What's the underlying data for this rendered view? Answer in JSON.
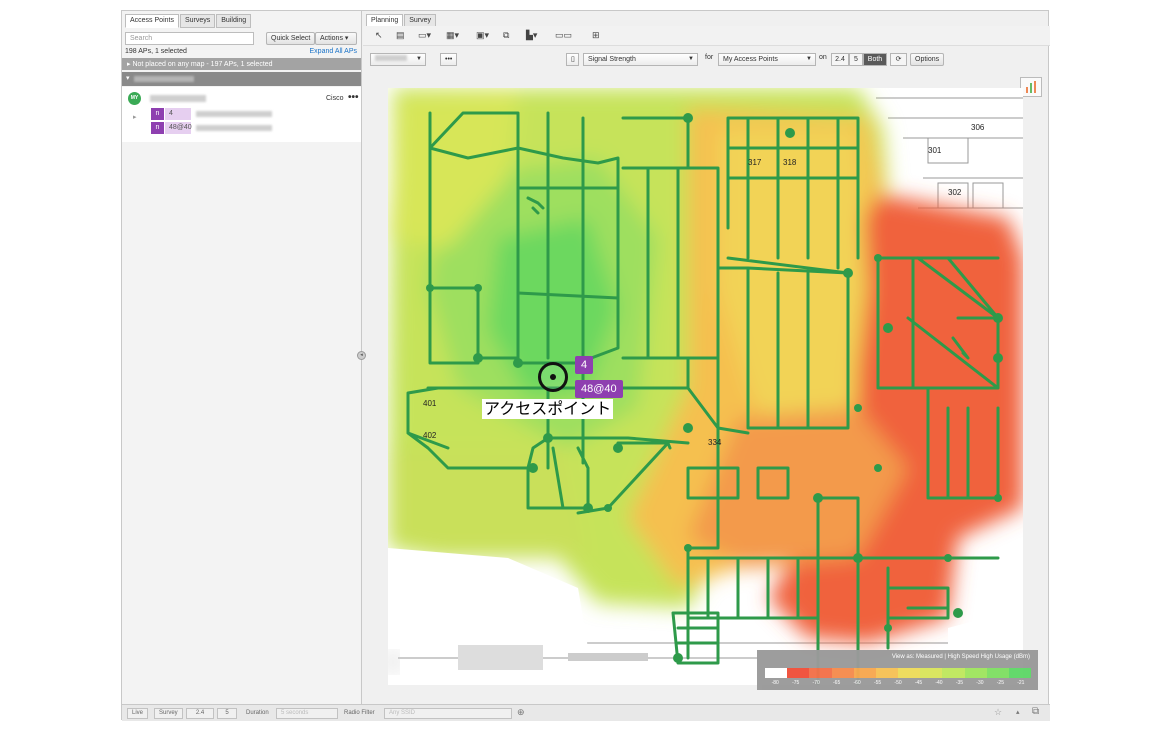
{
  "left_panel": {
    "tabs": [
      "Access Points",
      "Surveys",
      "Building"
    ],
    "search_placeholder": "Search",
    "quick_select": "Quick Select",
    "actions": "Actions",
    "ap_count": "198 APs, 1 selected",
    "expand_all": "Expand All APs",
    "not_placed": "Not placed on any map - 197 APs, 1 selected",
    "ap_item": {
      "avatar": "MY",
      "vendor": "Cisco",
      "more": "•••",
      "radios": [
        {
          "badge": "n",
          "channel": "4"
        },
        {
          "badge": "n",
          "channel": "48@40"
        }
      ]
    }
  },
  "right_panel": {
    "tabs": [
      "Planning",
      "Survey"
    ],
    "visualization": "Signal Strength",
    "for_label": "for",
    "target": "My Access Points",
    "on_label": "on",
    "bands": [
      "2.4",
      "5",
      "Both"
    ],
    "active_band": "Both",
    "options": "Options",
    "ellipsis": "•••"
  },
  "map": {
    "ap_label": "アクセスポイント",
    "ap_channel_24": "4",
    "ap_channel_5": "48@40",
    "room_labels": [
      "301",
      "302",
      "306",
      "317",
      "318",
      "334",
      "401",
      "402"
    ],
    "legend": {
      "title": "View as: Measured | High Speed High Usage (dBm)",
      "colors": [
        "#ffffff",
        "#f0503a",
        "#f3714a",
        "#f58c4e",
        "#f7a850",
        "#f6c256",
        "#eedb5a",
        "#d9e55c",
        "#bfe85e",
        "#9fe560",
        "#7fe064",
        "#5fd868"
      ],
      "ticks": [
        "-80",
        "-75",
        "-70",
        "-65",
        "-60",
        "-55",
        "-50",
        "-45",
        "-40",
        "-35",
        "-30",
        "-25",
        "-21"
      ]
    }
  },
  "bottom_bar": {
    "live": "Live",
    "survey": "Survey",
    "band_24": "2.4",
    "band_5": "5",
    "duration_label": "Duration",
    "duration_value": "5 seconds",
    "radio_filter_label": "Radio Filter",
    "radio_filter_value": "Any SSID"
  }
}
